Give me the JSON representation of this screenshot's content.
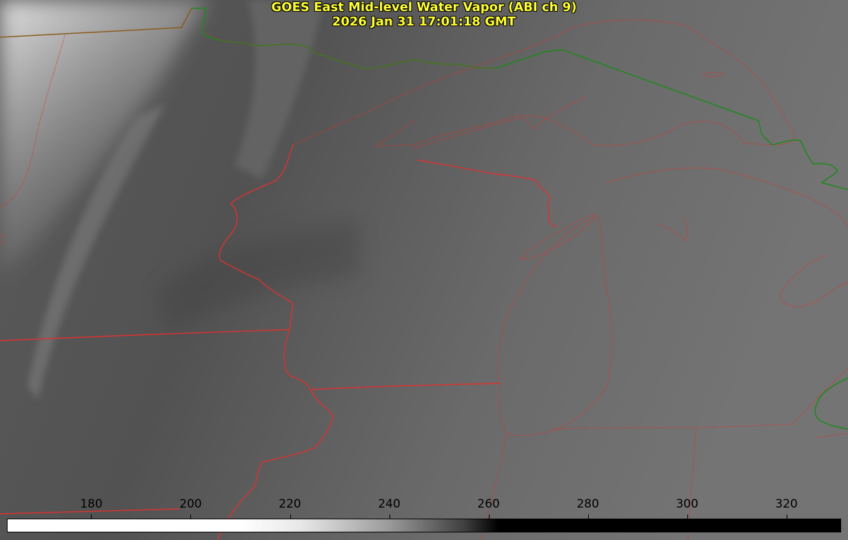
{
  "title": {
    "line1": "GOES East Mid-level Water Vapor (ABI ch 9)",
    "line2": "2026 Jan 31 17:01:18 GMT"
  },
  "colorbar": {
    "ticks": [
      "180",
      "200",
      "220",
      "240",
      "260",
      "280",
      "300",
      "320"
    ],
    "range": [
      163,
      331
    ],
    "gradient": [
      {
        "value": 163,
        "color": "#ffffff"
      },
      {
        "value": 210,
        "color": "#ffffff"
      },
      {
        "value": 222,
        "color": "#e8e8e8"
      },
      {
        "value": 240,
        "color": "#9a9a9a"
      },
      {
        "value": 255,
        "color": "#404040"
      },
      {
        "value": 262,
        "color": "#000000"
      },
      {
        "value": 331,
        "color": "#000000"
      }
    ]
  },
  "colors": {
    "state_borders": "#e03030",
    "coastlines": "#e03030",
    "international_border": "#1a8a1a",
    "title": "#ffff33"
  }
}
